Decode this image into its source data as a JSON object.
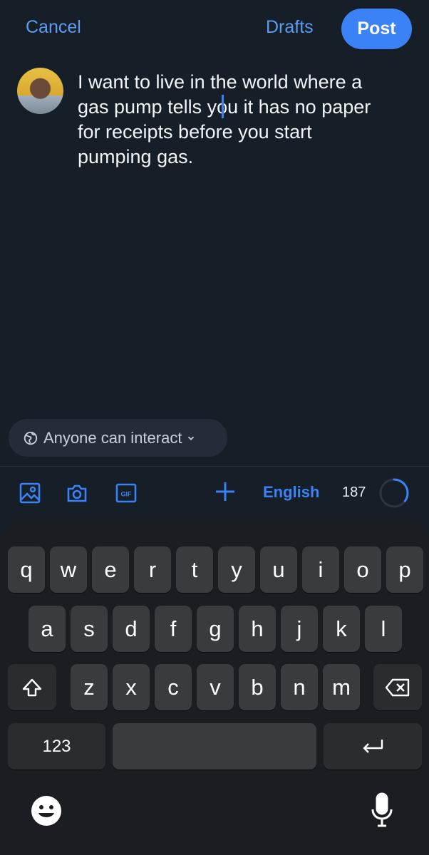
{
  "header": {
    "cancel_label": "Cancel",
    "drafts_label": "Drafts",
    "post_label": "Post"
  },
  "compose": {
    "text": "I want to live in the world where a\ngas pump tells you it has no paper\nfor receipts before you start\npumping gas."
  },
  "audience": {
    "label": "Anyone can interact"
  },
  "toolbar": {
    "icons": [
      "image-icon",
      "camera-icon",
      "gif-icon",
      "plus-icon"
    ],
    "language": "English",
    "chars_remaining": "187",
    "progress_fraction": 0.35
  },
  "keyboard": {
    "row1": [
      "q",
      "w",
      "e",
      "r",
      "t",
      "y",
      "u",
      "i",
      "o",
      "p"
    ],
    "row2": [
      "a",
      "s",
      "d",
      "f",
      "g",
      "h",
      "j",
      "k",
      "l"
    ],
    "row3": [
      "z",
      "x",
      "c",
      "v",
      "b",
      "n",
      "m"
    ],
    "numbers_label": "123"
  },
  "colors": {
    "accent": "#3b82f6",
    "background": "#161e27",
    "keyboard_bg": "#1a1d21",
    "key_bg": "#3a3b3f"
  }
}
